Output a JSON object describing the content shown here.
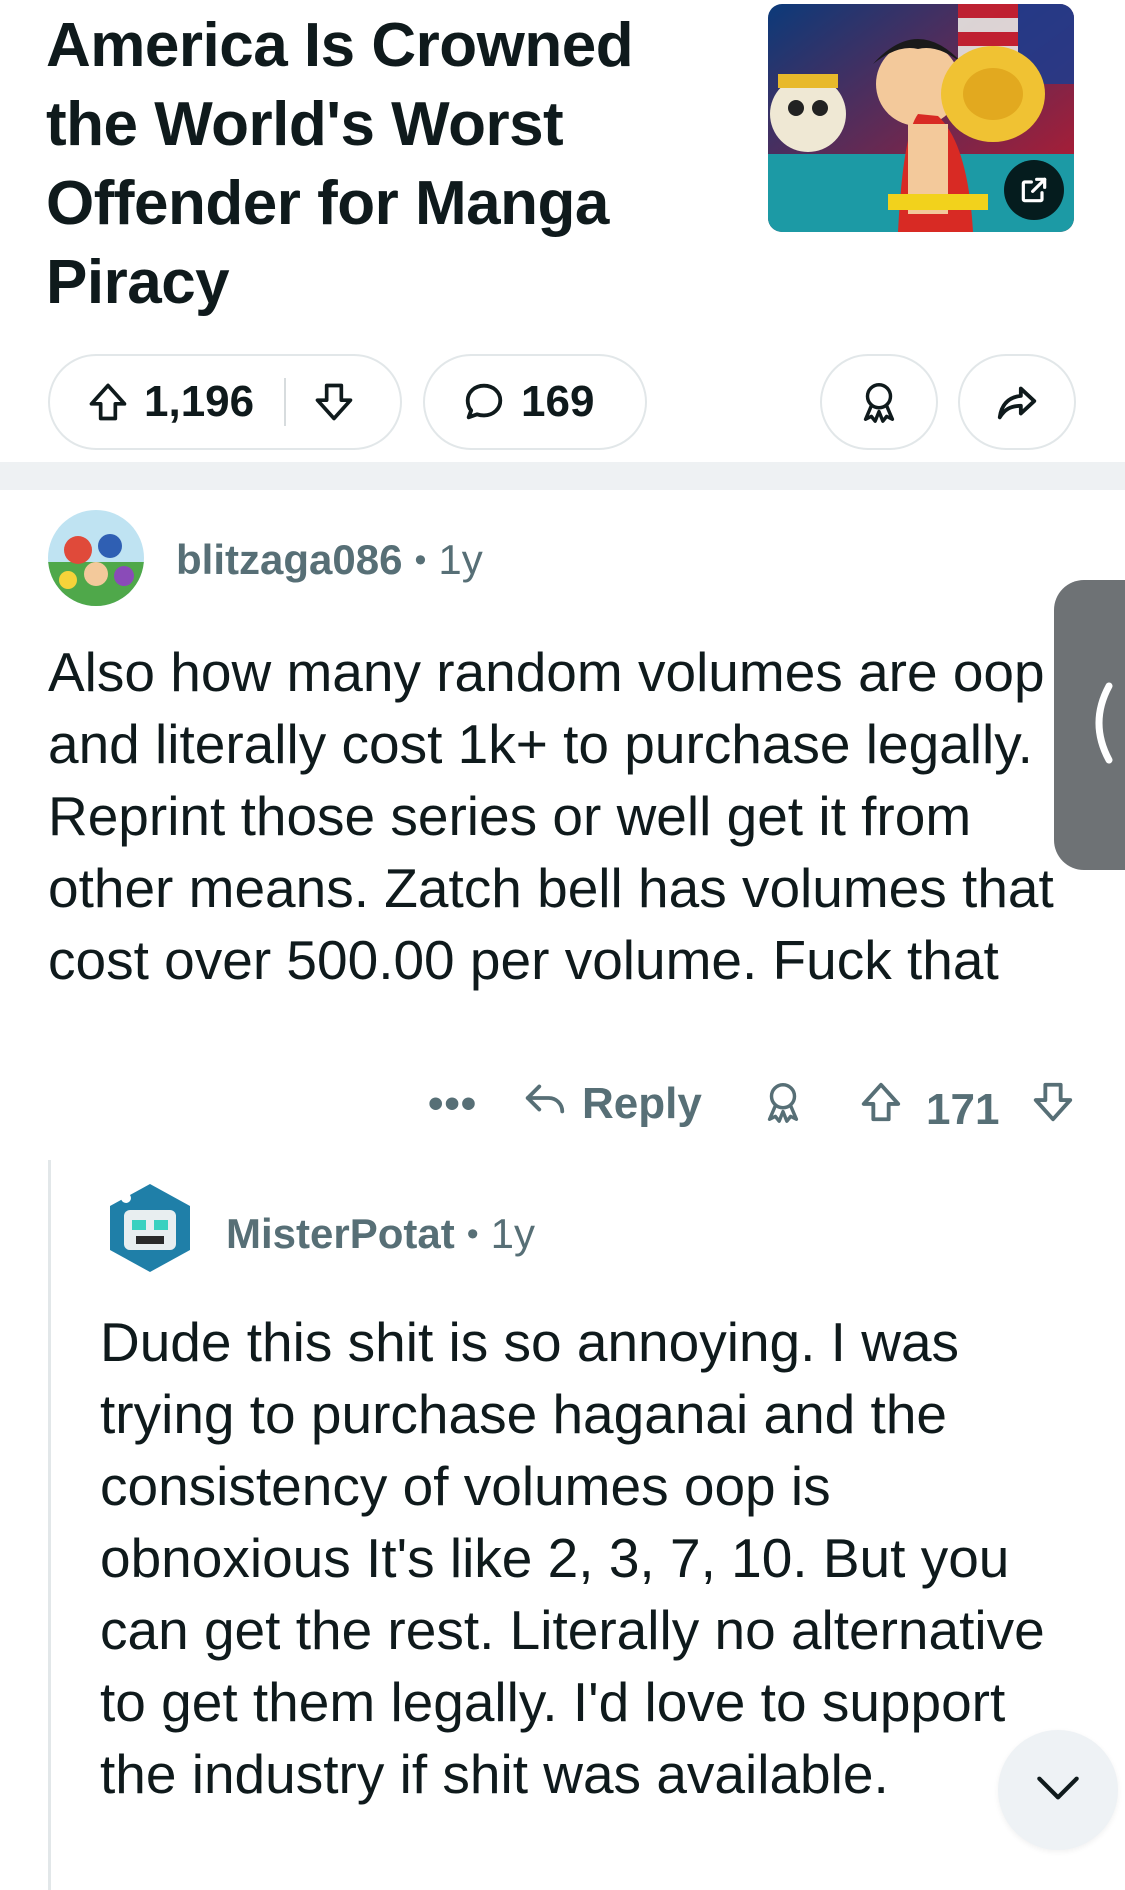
{
  "post": {
    "title": "America Is Crowned the World's Worst Offender for Manga Piracy",
    "votes": "1,196",
    "comments": "169"
  },
  "comments": [
    {
      "username": "blitzaga086",
      "age": "1y",
      "body": "Also how many random volumes are oop and literally cost 1k+ to purchase legally. Reprint those series or well get it from other means. Zatch bell has volumes that cost over 500.00 per volume. Fuck that",
      "reply_label": "Reply",
      "score": "171",
      "more_label": "•••"
    },
    {
      "username": "MisterPotat",
      "age": "1y",
      "body": "Dude this shit is so annoying. I was trying to purchase haganai and the consistency of volumes oop is obnoxious It's like 2, 3, 7, 10. But you can get the rest. Literally no alternative to get them legally. I'd love to support the industry if shit was available."
    }
  ],
  "meta_separator": "•",
  "icons": {
    "upvote": "arrow-up-icon",
    "downvote": "arrow-down-icon",
    "comment": "speech-bubble-icon",
    "award": "award-icon",
    "share": "share-arrow-icon",
    "external_link": "external-link-icon",
    "reply": "reply-arrow-icon",
    "side_tab": "chevron-left-icon",
    "scroll_down": "chevron-down-icon"
  },
  "colors": {
    "text": "#0f1a1c",
    "meta": "#576f76",
    "border": "#e2e7e9",
    "divider": "#eef1f3",
    "side_tab": "#6e7275"
  }
}
